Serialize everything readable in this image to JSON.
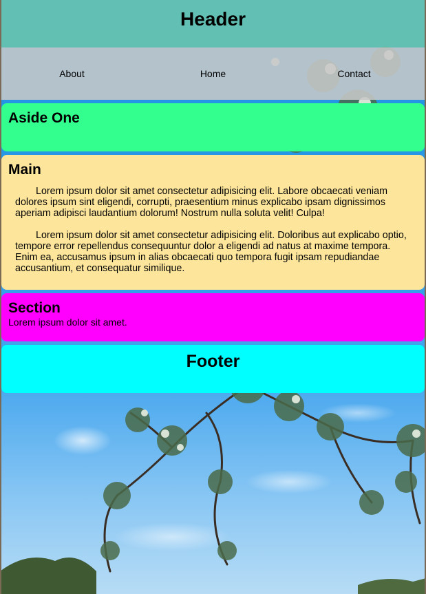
{
  "header": {
    "title": "Header"
  },
  "nav": {
    "items": [
      {
        "label": "About"
      },
      {
        "label": "Home"
      },
      {
        "label": "Contact"
      }
    ]
  },
  "aside": {
    "title": "Aside One"
  },
  "main": {
    "title": "Main",
    "paragraphs": [
      "Lorem ipsum dolor sit amet consectetur adipisicing elit. Labore obcaecati veniam dolores ipsum sint eligendi, corrupti, praesentium minus explicabo ipsam dignissimos aperiam adipisci laudantium dolorum! Nostrum nulla soluta velit! Culpa!",
      "Lorem ipsum dolor sit amet consectetur adipisicing elit. Doloribus aut explicabo optio, tempore error repellendus consequuntur dolor a eligendi ad natus at maxime tempora. Enim ea, accusamus ipsum in alias obcaecati quo tempora fugit ipsam repudiandae accusantium, et consequatur similique."
    ]
  },
  "section": {
    "title": "Section",
    "text": "Lorem ipsum dolor sit amet."
  },
  "footer": {
    "title": "Footer"
  },
  "colors": {
    "header_bg": "#6ec8aa",
    "nav_bg": "#c8c8c8",
    "aside_bg": "#33ff8f",
    "main_bg": "#fde59c",
    "section_bg": "#ff00ff",
    "footer_bg": "#00ffff"
  }
}
